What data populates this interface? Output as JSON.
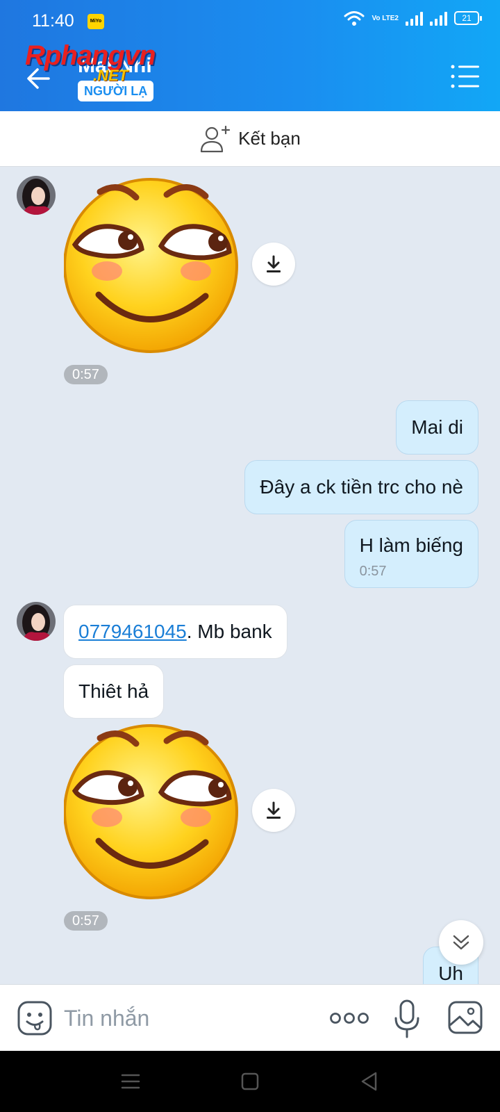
{
  "status_bar": {
    "time": "11:40",
    "carrier_badge": "MiYo",
    "network_label": "Vo LTE2",
    "battery": "21"
  },
  "header": {
    "contact_name": "Mai Nhi",
    "badge": "NGƯỜI LẠ",
    "watermark_main": "Rphangvn",
    "watermark_sub": ".NET"
  },
  "add_friend": {
    "label": "Kết bạn"
  },
  "messages": [
    {
      "type": "sticker",
      "sender": "them",
      "time": "0:57"
    },
    {
      "type": "text",
      "sender": "me",
      "text": "Mai di"
    },
    {
      "type": "text",
      "sender": "me",
      "text": "Đây a ck tiền trc cho nè"
    },
    {
      "type": "text",
      "sender": "me",
      "text": "H làm biếng",
      "time": "0:57"
    },
    {
      "type": "text",
      "sender": "them",
      "link": "0779461045",
      "text": ". Mb bank"
    },
    {
      "type": "text",
      "sender": "them",
      "text": "Thiêt hả"
    },
    {
      "type": "sticker",
      "sender": "them",
      "time": "0:57"
    },
    {
      "type": "text",
      "sender": "me",
      "text": "Uh"
    }
  ],
  "input": {
    "placeholder": "Tin nhắn"
  },
  "colors": {
    "header_gradient_start": "#1f77e0",
    "header_gradient_end": "#12a7f6",
    "chat_background": "#e2e9f2",
    "outgoing_bubble": "#d4eefd",
    "incoming_bubble": "#ffffff",
    "link": "#1a7ed6"
  }
}
